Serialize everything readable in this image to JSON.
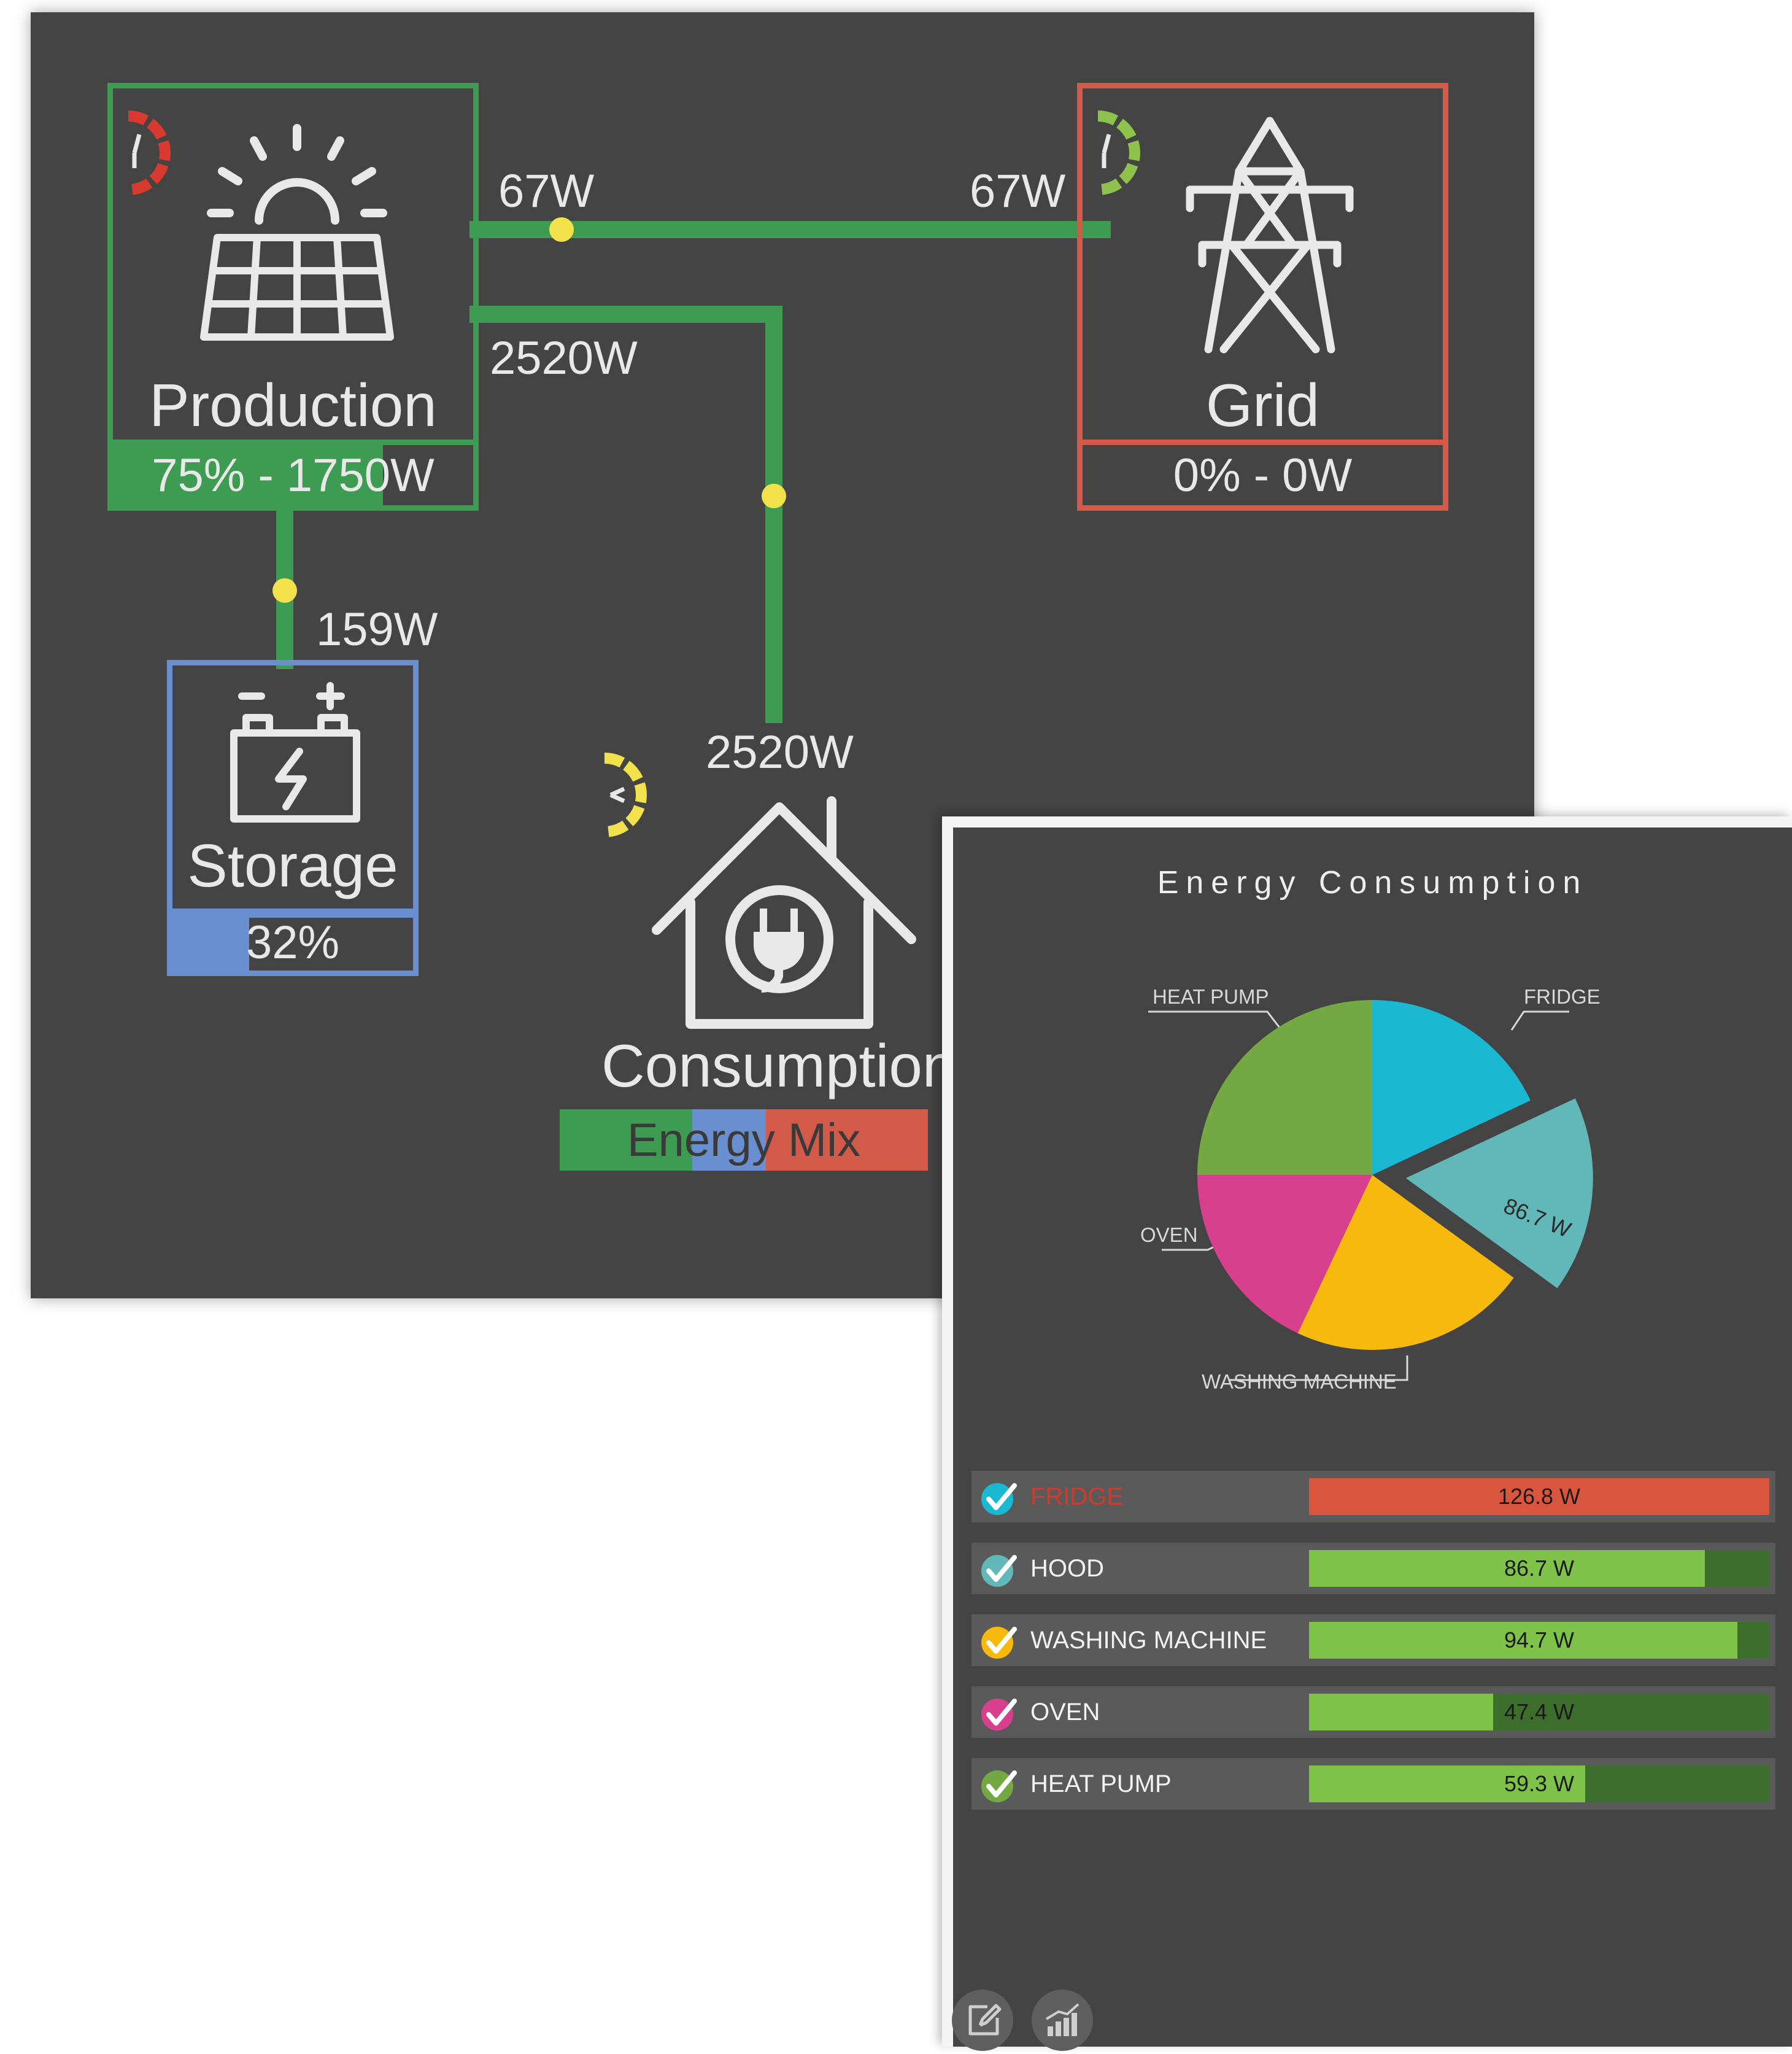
{
  "flow": {
    "production": {
      "label": "Production",
      "share_label": "75% - 1750W",
      "share": 0.75,
      "color": "#3e9b52"
    },
    "grid": {
      "label": "Grid",
      "share_label": "0% - 0W",
      "share": 0.0,
      "color": "#d35a48"
    },
    "storage": {
      "label": "Storage",
      "charge_label": "32%",
      "charge": 0.32,
      "color": "#6a8fd0",
      "minus": "-",
      "plus": "+"
    },
    "consumption": {
      "label": "Consumption",
      "mix_label": "Energy Mix",
      "mix": [
        {
          "source": "production",
          "share": 0.36,
          "color": "#3e9b52"
        },
        {
          "source": "storage",
          "share": 0.2,
          "color": "#6a8fd0"
        },
        {
          "source": "grid",
          "share": 0.44,
          "color": "#d35a48"
        }
      ]
    },
    "flows": {
      "production_to_grid_start": "67W",
      "production_to_grid_end": "67W",
      "production_to_consumption_start": "2520W",
      "production_to_consumption_end": "2520W",
      "production_to_storage": "159W"
    },
    "colors": {
      "flow_line": "#3e9b52",
      "flow_dot": "#f2e14a",
      "background": "#444444"
    }
  },
  "panel": {
    "title": "Energy Consumption",
    "pie_labels": {
      "heat_pump": "HEAT PUMP",
      "fridge": "FRIDGE",
      "oven": "OVEN",
      "washing_machine": "WASHING MACHINE",
      "hood_value": "86.7 W"
    },
    "devices": [
      {
        "name": "FRIDGE",
        "value": "126.8 W",
        "watts": 126.8,
        "level": 1.0,
        "icon_color": "#1ab8d2",
        "bar_color": "#d9553e",
        "name_color": "#d23a2e"
      },
      {
        "name": "HOOD",
        "value": "86.7 W",
        "watts": 86.7,
        "level": 0.86,
        "icon_color": "#62b8b8",
        "bar_color": "#7fc24a",
        "name_color": "#f2f2f2"
      },
      {
        "name": "WASHING MACHINE",
        "value": "94.7 W",
        "watts": 94.7,
        "level": 0.93,
        "icon_color": "#f7b90d",
        "bar_color": "#7fc24a",
        "name_color": "#f2f2f2"
      },
      {
        "name": "OVEN",
        "value": "47.4 W",
        "watts": 47.4,
        "level": 0.4,
        "icon_color": "#d8408e",
        "bar_color": "#7fc24a",
        "name_color": "#f2f2f2"
      },
      {
        "name": "HEAT PUMP",
        "value": "59.3 W",
        "watts": 59.3,
        "level": 0.6,
        "icon_color": "#74a843",
        "bar_color": "#7fc24a",
        "name_color": "#f2f2f2"
      }
    ],
    "pie_slices": [
      {
        "name": "FRIDGE",
        "share": 0.18,
        "color": "#1ab8d2"
      },
      {
        "name": "HOOD",
        "share": 0.17,
        "color": "#62b8b8",
        "exploded": true
      },
      {
        "name": "WASHING MACHINE",
        "share": 0.22,
        "color": "#f7b90d"
      },
      {
        "name": "OVEN",
        "share": 0.18,
        "color": "#d8408e"
      },
      {
        "name": "HEAT PUMP",
        "share": 0.25,
        "color": "#74a843"
      }
    ],
    "toolbar": [
      {
        "icon": "edit-icon"
      },
      {
        "icon": "bar-chart-icon"
      }
    ]
  }
}
